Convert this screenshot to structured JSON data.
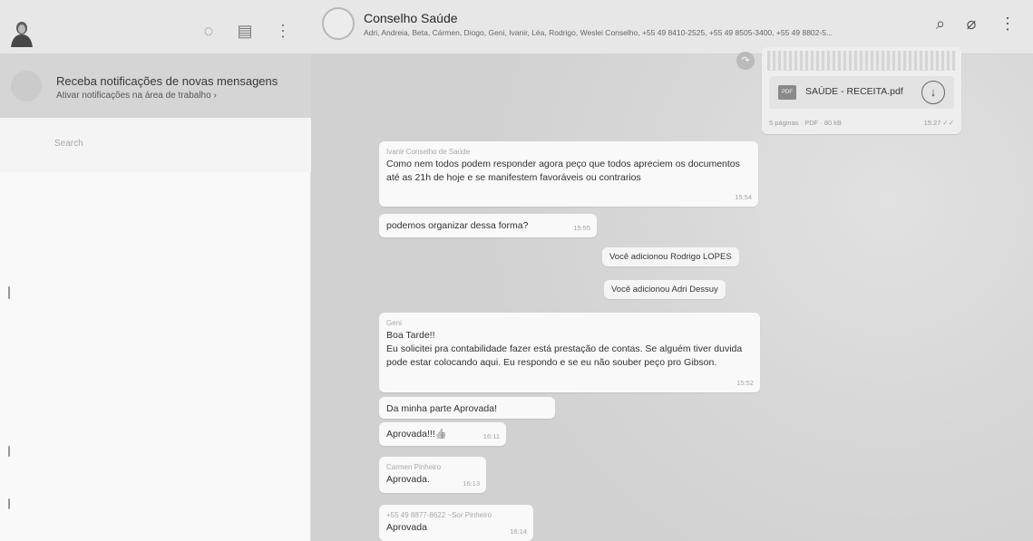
{
  "left_header": {
    "status_icon": "status-icon",
    "chat_icon": "new-chat-icon",
    "menu_icon": "menu-icon"
  },
  "notification": {
    "title": "Receba notificações de novas mensagens",
    "subtitle": "Ativar notificações na área de trabalho ›"
  },
  "search": {
    "placeholder": "Search"
  },
  "chat_header": {
    "title": "Conselho  Saúde",
    "members": "Adri, Andreia, Beta, Cármen, Diogo, Geni, Ivanir, Léa, Rodrigo, Weslei Conselho, +55 49 8410-2525, +55 49 8505-3400, +55 49 8802-5...",
    "search_icon": "search-icon",
    "attach_icon": "paperclip-icon",
    "menu_icon": "menu-icon"
  },
  "pdf": {
    "badge": "PDF",
    "name": "SAÚDE - RECEITA.pdf",
    "meta": "5 páginas · PDF · 80 kB",
    "time": "15:27 ✓✓"
  },
  "messages": [
    {
      "sender": "Ivanir Conselho de Saúde",
      "text": "Como nem todos podem responder agora peço que todos apreciem os documentos até as 21h de hoje e se manifestem favoráveis ou contrarios",
      "time": "15:54"
    },
    {
      "sender": "",
      "text": "podemos organizar dessa forma?",
      "time": "15:55"
    }
  ],
  "system": [
    "Você adicionou Rodrigo LOPES",
    "Você adicionou Adri Dessuy"
  ],
  "geni_message": {
    "sender": "Geni",
    "line1": "Boa Tarde!!",
    "body": "Eu solicitei pra contabilidade fazer está prestação de contas. Se alguém tiver duvida pode estar colocando aqui.  Eu respondo e se eu não souber peço pro Gibson.",
    "time": "15:52"
  },
  "replies": [
    {
      "sender": "",
      "text": "Da minha parte  Aprovada!",
      "time": ""
    },
    {
      "sender": "",
      "text": "Aprovada!!!👍",
      "time": "16:11"
    },
    {
      "sender": "Carmen Pinheiro",
      "text": "Aprovada.",
      "time": "16:13"
    },
    {
      "sender": "+55 49 8877-8622 ~Sor Pinheiro",
      "text": "Aprovada",
      "time": "16:14"
    }
  ]
}
